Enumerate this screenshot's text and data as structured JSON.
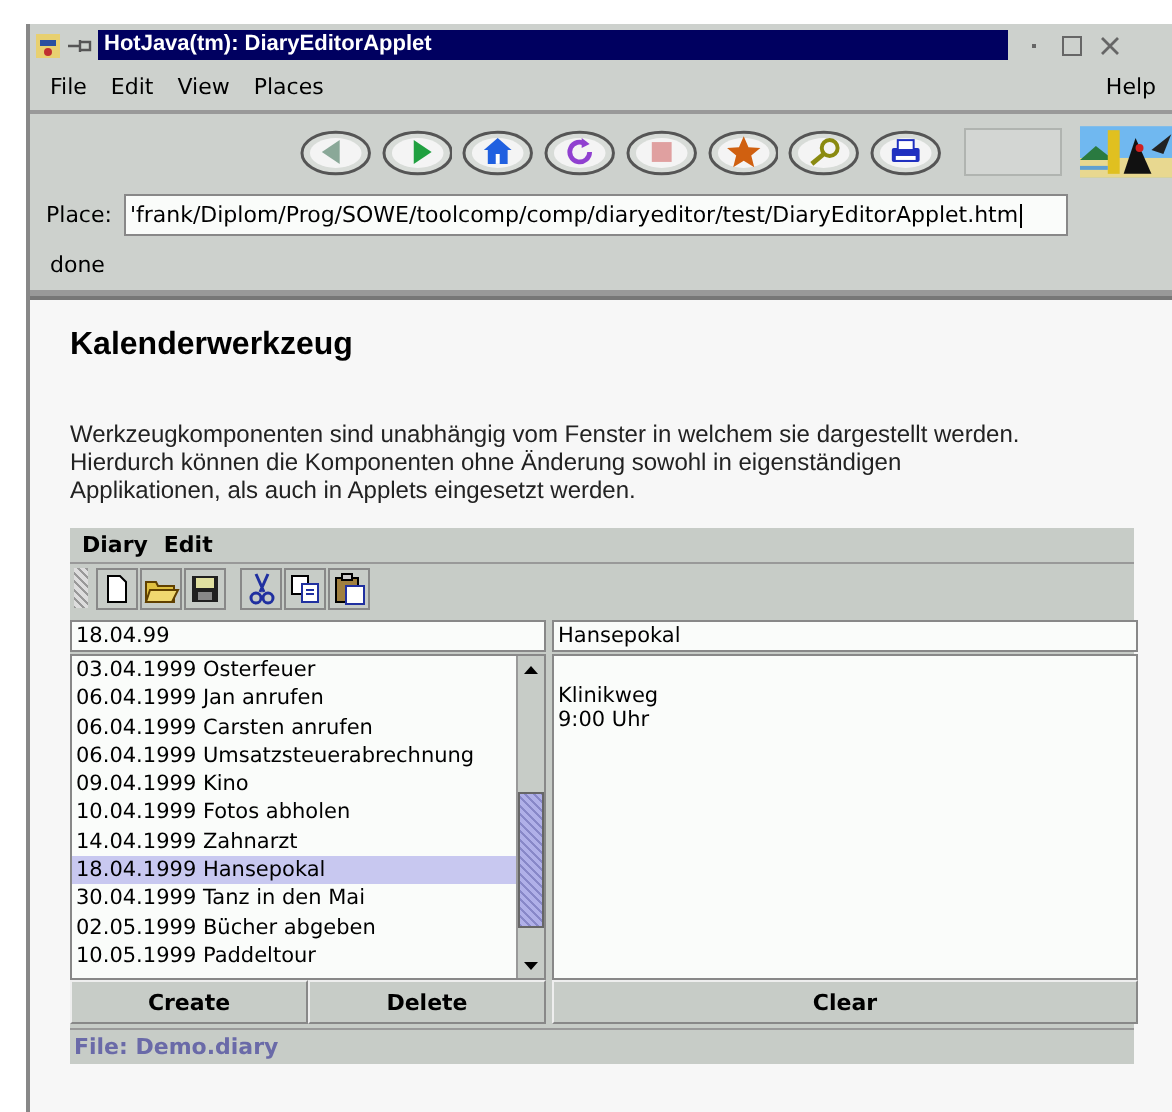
{
  "window": {
    "title": "HotJava(tm): DiaryEditorApplet"
  },
  "menu": [
    "File",
    "Edit",
    "View",
    "Places"
  ],
  "help_menu": "Help",
  "place": {
    "label": "Place:",
    "value": "'frank/Diplom/Prog/SOWE/toolcomp/comp/diaryeditor/test/DiaryEditorApplet.htm"
  },
  "status": "done",
  "page": {
    "heading": "Kalenderwerkzeug",
    "paragraph": "Werkzeugkomponenten sind unabhängig vom Fenster in welchem sie dargestellt werden. Hierdurch können die Komponenten ohne Änderung sowohl in eigenständigen Applikationen, als auch in Applets eingesetzt werden."
  },
  "applet": {
    "menu": [
      "Diary",
      "Edit"
    ],
    "date_field": {
      "value": "18.04.99"
    },
    "entries": [
      {
        "label": "03.04.1999 Osterfeuer",
        "selected": false
      },
      {
        "label": "06.04.1999 Jan anrufen",
        "selected": false
      },
      {
        "label": "06.04.1999 Carsten anrufen",
        "selected": false
      },
      {
        "label": "06.04.1999 Umsatzsteuerabrechnung",
        "selected": false
      },
      {
        "label": "09.04.1999 Kino",
        "selected": false
      },
      {
        "label": "10.04.1999 Fotos abholen",
        "selected": false
      },
      {
        "label": "14.04.1999 Zahnarzt",
        "selected": false
      },
      {
        "label": "18.04.1999 Hansepokal",
        "selected": true
      },
      {
        "label": "30.04.1999 Tanz in den Mai",
        "selected": false
      },
      {
        "label": "02.05.1999 Bücher abgeben",
        "selected": false
      },
      {
        "label": "10.05.1999 Paddeltour",
        "selected": false
      }
    ],
    "title_field": {
      "value": "Hansepokal"
    },
    "notes": [
      "Klinikweg",
      "9:00 Uhr"
    ],
    "buttons": [
      "Create",
      "Delete"
    ],
    "clear_button": "Clear",
    "status": "File: Demo.diary"
  }
}
